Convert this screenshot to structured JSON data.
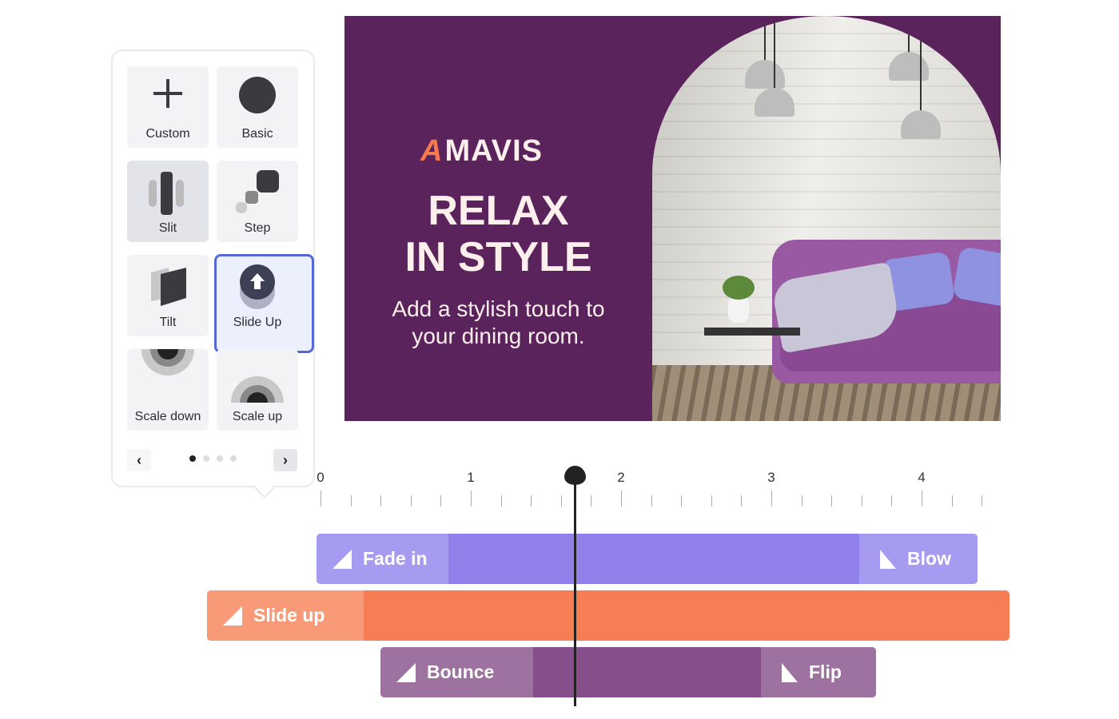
{
  "panel": {
    "tiles": [
      {
        "label": "Custom",
        "icon": "plus-icon"
      },
      {
        "label": "Basic",
        "icon": "circle-icon"
      },
      {
        "label": "Slit",
        "icon": "slit-icon",
        "active": true
      },
      {
        "label": "Step",
        "icon": "step-icon"
      },
      {
        "label": "Tilt",
        "icon": "tilt-icon"
      },
      {
        "label": "Slide Up",
        "icon": "arrow-up-circle-icon",
        "selected": true
      },
      {
        "label": "Scale down",
        "icon": "scale-down-icon"
      },
      {
        "label": "Scale up",
        "icon": "scale-up-icon"
      }
    ],
    "prev": "‹",
    "next": "›",
    "page": 1,
    "pages": 4,
    "selected_color": "#5468d8"
  },
  "slide": {
    "brand": "MAVIS",
    "headline1": "RELAX",
    "headline2": "IN STYLE",
    "subtitle1": "Add a stylish touch to",
    "subtitle2": "your dining room.",
    "bg_color": "#5a235c",
    "accent": "#f57b4f"
  },
  "timeline": {
    "ruler": [
      "0",
      "1",
      "2",
      "3",
      "4"
    ],
    "playhead": 1.69,
    "tracks": [
      {
        "in": "Fade in",
        "out": "Blow",
        "color": "#8f80ea",
        "edge": "#a59bf0"
      },
      {
        "in": "Slide up",
        "color": "#f77d55",
        "edge": "#f89a78"
      },
      {
        "in": "Bounce",
        "out": "Flip",
        "color": "#864f8b",
        "edge": "#9e72a0"
      }
    ]
  }
}
